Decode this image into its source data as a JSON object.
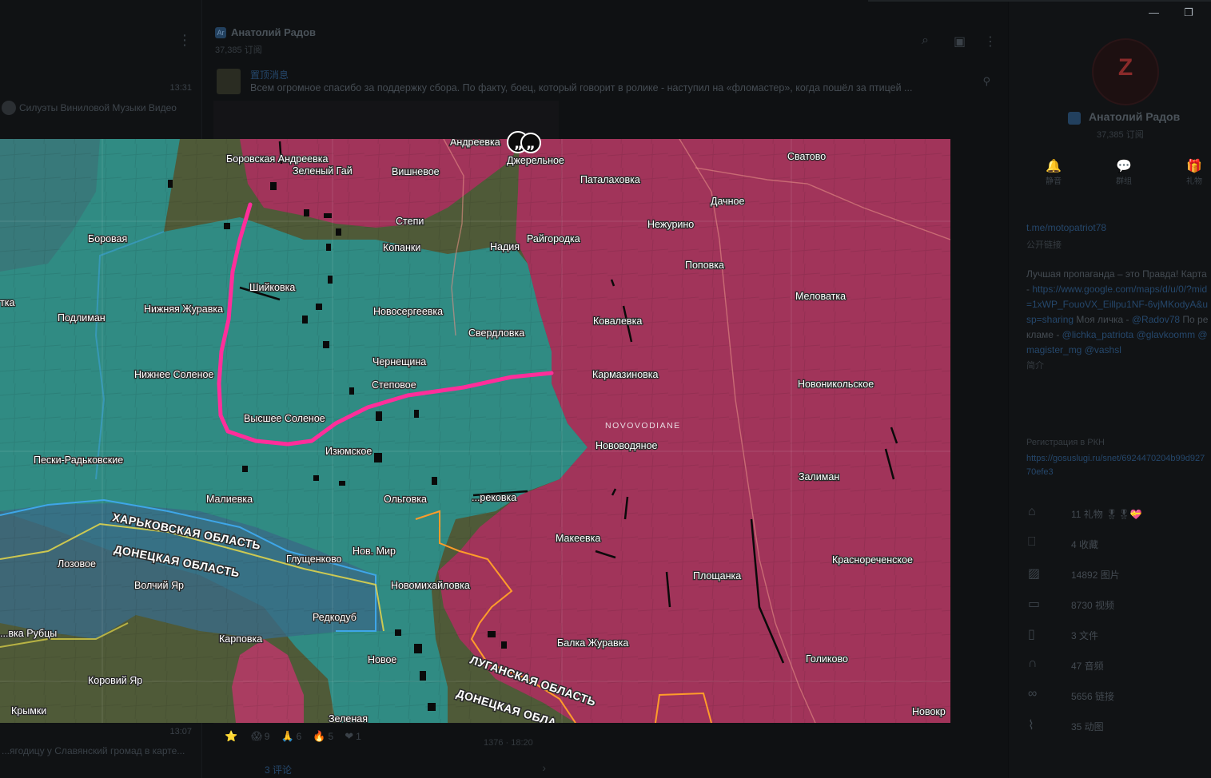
{
  "left_sidebar": {
    "chat_time": "13:31",
    "chat_preview": "Силуэты Виниловой Музыки Видео",
    "bottom_time": "13:07",
    "bottom_preview": "...ягодицу у Славянский громад в карте..."
  },
  "channel": {
    "name": "Анатолий Радов",
    "subscribers": "37,385 订阅",
    "pinned_title": "置顶消息",
    "pinned_text": "Всем огромное спасибо за поддержку сбора. По факту, боец, который говорит в ролике - наступил на «фломастер», когда пошёл за птицей ...",
    "views": "1376 · 18:20",
    "comments_label": "3 评论"
  },
  "reactions": [
    {
      "emoji": "⭐",
      "count": ""
    },
    {
      "emoji": "😱",
      "count": "9"
    },
    {
      "emoji": "🙏",
      "count": "6"
    },
    {
      "emoji": "🔥",
      "count": "5"
    },
    {
      "emoji": "❤",
      "count": "1"
    }
  ],
  "profile": {
    "name": "Анатолий Радов",
    "subscribers": "37,385 订阅",
    "avatar_letter": "Z",
    "actions": [
      {
        "icon": "bell-icon",
        "label": "静音"
      },
      {
        "icon": "chat-icon",
        "label": "群组"
      },
      {
        "icon": "gift-icon",
        "label": "礼物"
      }
    ],
    "link": "t.me/motopatriot78",
    "link_label": "公开链接",
    "desc_intro": "Лучшая пропаганда – это Правда! Карта -",
    "desc_map_link": "https://www.google.com/maps/d/u/0/?mid=1xWP_FouoVX_Eillpu1NF-6vjMKodyA&usp=sharing",
    "desc_contact_label": "Моя личка -",
    "desc_contact": "@Radov78",
    "desc_ads_label": "По рекламе -",
    "desc_ads": "@lichka_patriota @glavkoomm @magister_mg @vashsl",
    "desc_more": "简介",
    "reg_title": "Регистрация в РКН",
    "reg_link": "https://gosuslugi.ru/snet/6924470204b99d92770efe3",
    "stats": [
      {
        "icon": "gift-icon",
        "text": "11 礼物 🎖🎖💝"
      },
      {
        "icon": "bookmark-icon",
        "text": "4 收藏"
      },
      {
        "icon": "photo-icon",
        "text": "14892 图片"
      },
      {
        "icon": "video-icon",
        "text": "8730 视频"
      },
      {
        "icon": "file-icon",
        "text": "3 文件"
      },
      {
        "icon": "headphones-icon",
        "text": "47 音频"
      },
      {
        "icon": "link-icon",
        "text": "5656 链接"
      },
      {
        "icon": "gif-icon",
        "text": "35 动图"
      }
    ]
  },
  "map": {
    "colors": {
      "ukraine_zone": "#2e8f8a",
      "russia_zone": "#a8315d",
      "line": "#ff2e9a",
      "region_border": "#3d9de0",
      "oblast_border_luhansk": "#ff9c2a"
    },
    "labels": {
      "borovskaya_andreevka": "Боровская Андреевка",
      "zeleny_gai": "Зеленый Гай",
      "vishnevoe": "Вишневое",
      "andreevka": "Андреевка",
      "dzherelnoe": "Джерельное",
      "patalakhovka": "Паталаховка",
      "svatovo": "Сватово",
      "dachnoe": "Дачное",
      "stepi": "Степи",
      "nezhurino": "Нежурино",
      "borovaya": "Боровая",
      "kopanki": "Копанки",
      "nadiya": "Надия",
      "raygorodka": "Райгородка",
      "popovka": "Поповка",
      "shiykovka": "Шийковка",
      "nizhnyaya_zhuravka": "Нижняя Журавка",
      "novosergeevka": "Новосергеевка",
      "melovatka": "Меловатка",
      "podliman": "Подлиман",
      "sverdlovka": "Свердловка",
      "kovaleevka": "Ковалевка",
      "chernestchina": "Чернещина",
      "nizhnee_solenoe": "Нижнее Соленое",
      "stepovoe": "Степовое",
      "karmazinovka": "Кармазиновка",
      "novonikolskoe": "Новоникольское",
      "vysshee_solenoe": "Высшее Соленое",
      "novovodiane_caps": "NOVOVODIANE",
      "novovodyanoe": "Нововодяное",
      "izyumskoe": "Изюмское",
      "peski_radkovskie": "Пески-Радьковские",
      "zaliman": "Залиман",
      "malievka": "Малиевка",
      "olgovka": "Ольговка",
      "berekovka": "...рековка",
      "makeevka": "Макеевка",
      "kharkov_oblast": "ХАРЬКОВСКАЯ ОБЛАСТЬ",
      "donetsk_oblast": "ДОНЕЦКАЯ ОБЛАСТЬ",
      "donetsk_oblast_2": "ДОНЕЦКАЯ ОБЛА...",
      "luhansk_oblast": "ЛУГАНСКАЯ ОБЛАСТЬ",
      "lozovoe": "Лозовое",
      "glushchenkovo": "Глущенково",
      "nov_mir": "Нов. Мир",
      "krasnorechenskoe": "Краснореченское",
      "volchiy_yar": "Волчий Яр",
      "novomikhailovka": "Новомихайловка",
      "ploshchanka": "Площанка",
      "redkodub": "Редкодуб",
      "rubtsy": "...вка Рубцы",
      "karpovka": "Карповка",
      "balka_zhuravka": "Балка Журавка",
      "novoe": "Новое",
      "golikovo": "Голиково",
      "koroviy_yar": "Коровий Яр",
      "krymki": "Крымки",
      "zelenaya": "Зеленая",
      "novokr": "Новокр",
      "tka": "тка"
    }
  }
}
